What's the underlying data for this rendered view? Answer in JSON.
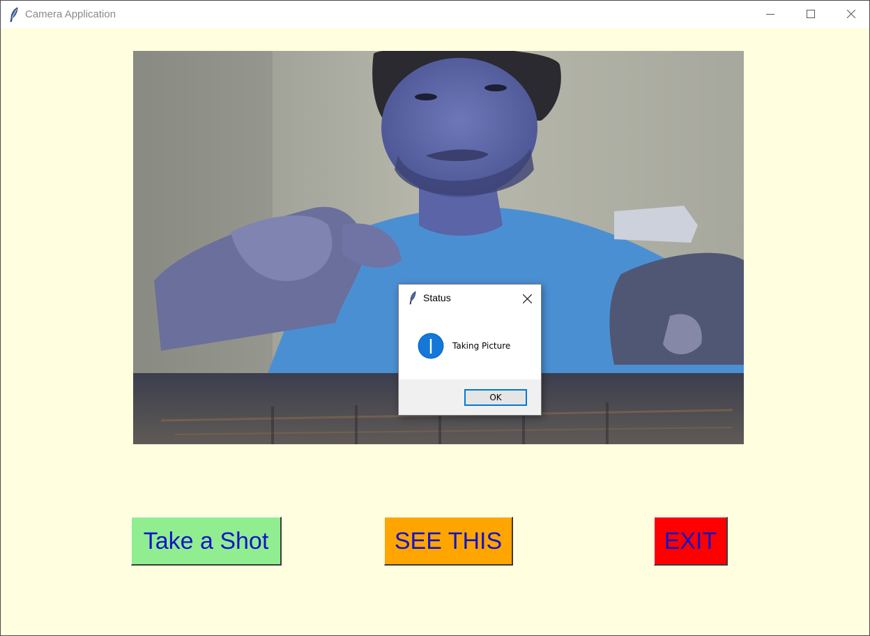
{
  "window": {
    "title": "Camera Application",
    "icon": "feather-icon",
    "controls": [
      "minimize-icon",
      "maximize-icon",
      "close-icon"
    ]
  },
  "camera": {
    "description_icon": "camera-feed"
  },
  "buttons": {
    "take_shot": "Take a Shot",
    "see_this": "SEE THIS",
    "exit": "EXIT"
  },
  "colors": {
    "background": "#fffedf",
    "take_shot_bg": "#90ee90",
    "see_this_bg": "#ffa500",
    "exit_bg": "#ff0000",
    "button_text": "#1313c8"
  },
  "dialog": {
    "title": "Status",
    "message": "Taking Picture",
    "ok_label": "OK",
    "icon": "info-icon"
  }
}
